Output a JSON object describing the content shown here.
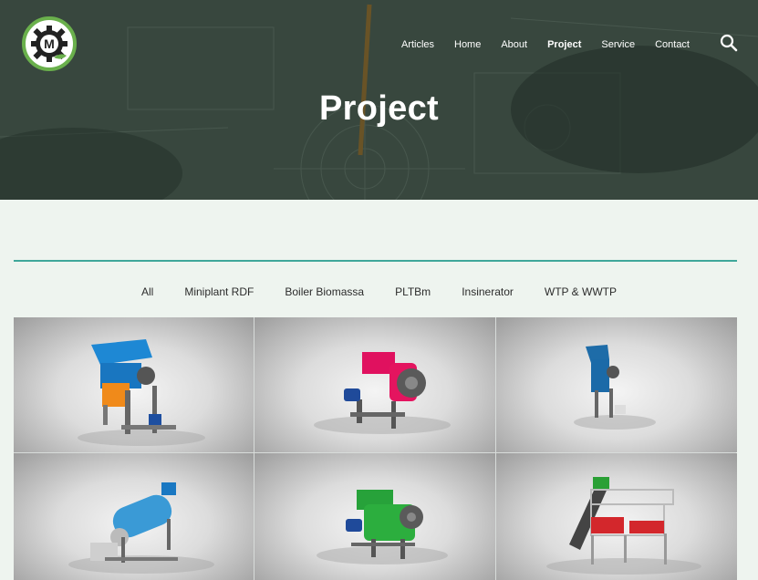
{
  "header": {
    "logo_letter": "M",
    "nav": [
      "Articles",
      "Home",
      "About",
      "Project",
      "Service",
      "Contact"
    ],
    "active_nav": "Project",
    "title": "Project"
  },
  "filters": [
    "All",
    "Miniplant RDF",
    "Boiler Biomassa",
    "PLTBm",
    "Insinerator",
    "WTP & WWTP"
  ],
  "colors": {
    "accent": "#3fa79a",
    "logo_green": "#6ab04c",
    "background": "#eef4ef"
  },
  "icons": [
    "gear-logo-icon",
    "search-icon"
  ]
}
